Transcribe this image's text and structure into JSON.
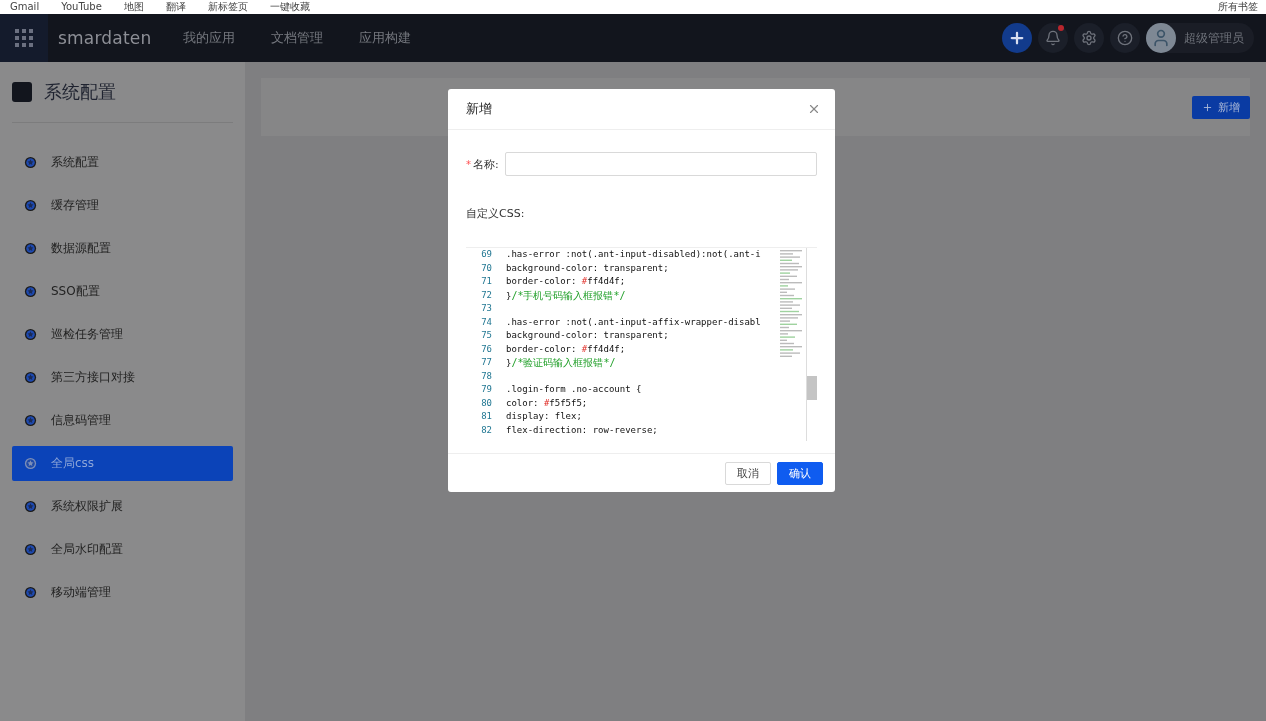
{
  "bookmarks": [
    "Gmail",
    "YouTube",
    "地图",
    "翻译",
    "新标签页",
    "一键收藏"
  ],
  "bookmarks_end": "所有书签",
  "header": {
    "logo": "smardaten",
    "nav": [
      "我的应用",
      "文档管理",
      "应用构建"
    ],
    "user": "超级管理员",
    "notification_dot": true
  },
  "sidebar": {
    "title": "系统配置",
    "items": [
      {
        "label": "系统配置",
        "selected": false
      },
      {
        "label": "缓存管理",
        "selected": false
      },
      {
        "label": "数据源配置",
        "selected": false
      },
      {
        "label": "SSO配置",
        "selected": false
      },
      {
        "label": "巡检任务管理",
        "selected": false
      },
      {
        "label": "第三方接口对接",
        "selected": false
      },
      {
        "label": "信息码管理",
        "selected": false
      },
      {
        "label": "全局css",
        "selected": true
      },
      {
        "label": "系统权限扩展",
        "selected": false
      },
      {
        "label": "全局水印配置",
        "selected": false
      },
      {
        "label": "移动端管理",
        "selected": false
      }
    ]
  },
  "toolbar": {
    "add_button": "新增"
  },
  "dialog": {
    "title": "新增",
    "name_label": "名称:",
    "name_required": true,
    "required_mark": "*",
    "css_label": "自定义CSS:",
    "code_lines": [
      {
        "number": "69",
        "segments": [
          {
            "kind": "plain",
            "text": ".has-error :not(.ant-input-disabled):not(.ant-i"
          }
        ]
      },
      {
        "number": "70",
        "segments": [
          {
            "kind": "plain",
            "text": "background-color: transparent;"
          }
        ]
      },
      {
        "number": "71",
        "segments": [
          {
            "kind": "plain",
            "text": "border-color: "
          },
          {
            "kind": "hash",
            "text": "#"
          },
          {
            "kind": "plain",
            "text": "ff4d4f;"
          }
        ]
      },
      {
        "number": "72",
        "segments": [
          {
            "kind": "plain",
            "text": "}"
          },
          {
            "kind": "comment",
            "text": "/*手机号码输入框报错*/"
          }
        ]
      },
      {
        "number": "73"
      },
      {
        "number": "74",
        "segments": [
          {
            "kind": "plain",
            "text": ".has-error :not(.ant-input-affix-wrapper-disabl"
          }
        ]
      },
      {
        "number": "75",
        "segments": [
          {
            "kind": "plain",
            "text": "background-color: transparent;"
          }
        ]
      },
      {
        "number": "76",
        "segments": [
          {
            "kind": "plain",
            "text": "border-color: "
          },
          {
            "kind": "hash",
            "text": "#"
          },
          {
            "kind": "plain",
            "text": "ff4d4f;"
          }
        ]
      },
      {
        "number": "77",
        "segments": [
          {
            "kind": "plain",
            "text": "}"
          },
          {
            "kind": "comment",
            "text": "/*验证码输入框报错*/"
          }
        ]
      },
      {
        "number": "78"
      },
      {
        "number": "79",
        "segments": [
          {
            "kind": "plain",
            "text": ".login-form .no-account {"
          }
        ]
      },
      {
        "number": "80",
        "segments": [
          {
            "kind": "plain",
            "text": "color: "
          },
          {
            "kind": "hash",
            "text": "#"
          },
          {
            "kind": "plain",
            "text": "f5f5f5;"
          }
        ]
      },
      {
        "number": "81",
        "segments": [
          {
            "kind": "plain",
            "text": "display: flex;"
          }
        ]
      },
      {
        "number": "82",
        "segments": [
          {
            "kind": "plain",
            "text": "flex-direction: row-reverse;"
          }
        ]
      }
    ],
    "cancel": "取消",
    "confirm": "确认"
  }
}
